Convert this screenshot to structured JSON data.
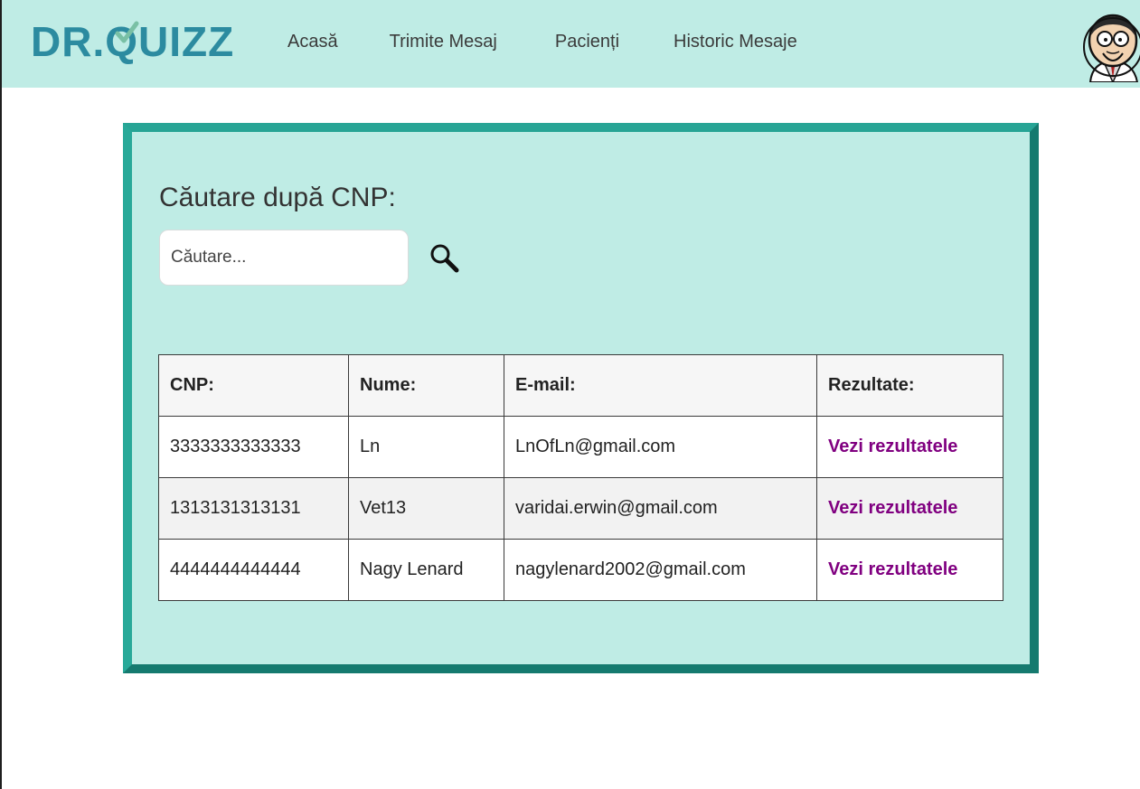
{
  "brand": {
    "logo_text_before": "DR.",
    "logo_text_q": "Q",
    "logo_text_after": "UIZZ",
    "logo_color": "#2c8ba0",
    "check_color": "#79c0a5"
  },
  "nav": {
    "items": [
      {
        "label": "Acasă"
      },
      {
        "label": "Trimite Mesaj"
      },
      {
        "label": "Pacienți"
      },
      {
        "label": "Historic Mesaje"
      }
    ],
    "background": "#bfece5"
  },
  "avatar": {
    "icon": "user-avatar-icon"
  },
  "search": {
    "title": "Căutare după CNP:",
    "placeholder": "Căutare...",
    "value": "",
    "icon": "search-icon"
  },
  "table": {
    "headers": {
      "cnp": "CNP:",
      "nume": "Nume:",
      "email": "E-mail:",
      "rezultate": "Rezultate:"
    },
    "rows": [
      {
        "cnp": "3333333333333",
        "nume": "Ln",
        "email": "LnOfLn@gmail.com",
        "rezultate": "Vezi rezultatele"
      },
      {
        "cnp": "1313131313131",
        "nume": "Vet13",
        "email": "varidai.erwin@gmail.com",
        "rezultate": "Vezi rezultatele"
      },
      {
        "cnp": "4444444444444",
        "nume": "Nagy Lenard",
        "email": "nagylenard2002@gmail.com",
        "rezultate": "Vezi rezultatele"
      }
    ]
  },
  "colors": {
    "panel_bg": "#bfece5",
    "panel_border": "#28a999",
    "link": "#800080"
  }
}
